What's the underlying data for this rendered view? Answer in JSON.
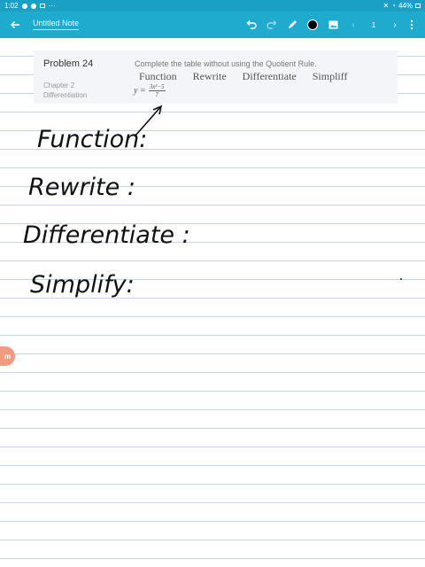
{
  "status_bar": {
    "time": "1:02",
    "battery": "44%",
    "more": "···"
  },
  "toolbar": {
    "title": "Untitled Note",
    "page_number": "1",
    "pen_color": "#000000",
    "accent": "#1eabce"
  },
  "problem": {
    "title": "Problem 24",
    "chapter": "Chapter 2",
    "topic": "Differentiation",
    "question": "Complete the table without using the Quotient Rule.",
    "headers": [
      "Function",
      "Rewrite",
      "Differentiate",
      "Simpliff"
    ],
    "formula_lhs": "y =",
    "formula_numerator": "3x²−5",
    "formula_denominator": "7"
  },
  "handwriting": {
    "line1": "Function:",
    "line2": "Rewrite :",
    "line3": "Differentiate :",
    "line4": "Simplify:"
  },
  "logo": {
    "text": "m"
  }
}
